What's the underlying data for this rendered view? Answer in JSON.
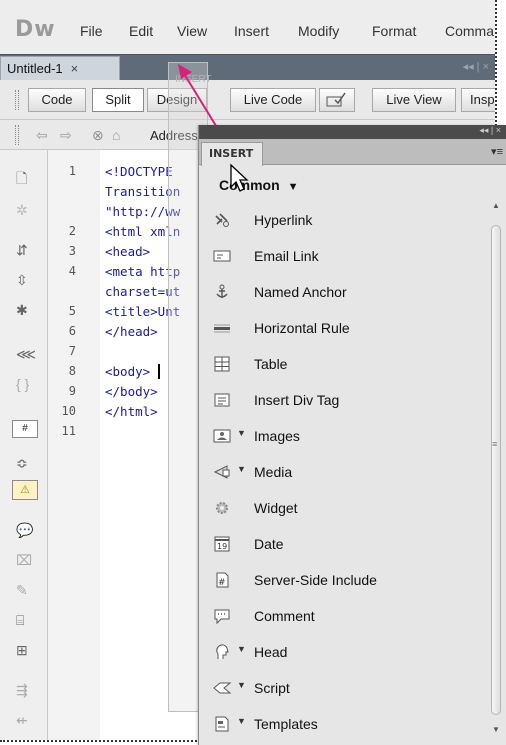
{
  "app": {
    "logo": "Dw"
  },
  "menu": [
    "File",
    "Edit",
    "View",
    "Insert",
    "Modify",
    "Format",
    "Comma"
  ],
  "document": {
    "tab_label": "Untitled-1",
    "tab_close": "×"
  },
  "window_controls": "◂◂ | ×",
  "toolbar": {
    "code": "Code",
    "split": "Split",
    "design": "Design",
    "live_code": "Live Code",
    "live_view": "Live View",
    "inspect": "Insp"
  },
  "address": {
    "label": "Address"
  },
  "code": {
    "line_numbers": [
      "1",
      "",
      "",
      "2",
      "3",
      "4",
      "",
      "5",
      "6",
      "7",
      "8",
      "9",
      "10",
      "11"
    ],
    "lines": [
      "<!DOCTYPE",
      "Transition",
      "\"http://ww",
      "<html xmln",
      "<head>",
      "<meta http",
      "charset=ut",
      "<title>Unt",
      "</head>",
      "",
      "<body>",
      "</body>",
      "</html>",
      ""
    ]
  },
  "ghost": {
    "title": "INSERT"
  },
  "panel": {
    "tab": "INSERT",
    "menu_icon": "▾≡",
    "collapse": "◂◂ | ×",
    "category": "Common",
    "category_arrow": "▼",
    "items": [
      {
        "label": "Hyperlink",
        "icon": "hyperlink-icon",
        "submenu": false
      },
      {
        "label": "Email Link",
        "icon": "email-link-icon",
        "submenu": false
      },
      {
        "label": "Named Anchor",
        "icon": "named-anchor-icon",
        "submenu": false
      },
      {
        "label": "Horizontal Rule",
        "icon": "horizontal-rule-icon",
        "submenu": false
      },
      {
        "label": "Table",
        "icon": "table-icon",
        "submenu": false
      },
      {
        "label": "Insert Div Tag",
        "icon": "div-tag-icon",
        "submenu": false
      },
      {
        "label": "Images",
        "icon": "images-icon",
        "submenu": true
      },
      {
        "label": "Media",
        "icon": "media-icon",
        "submenu": true
      },
      {
        "label": "Widget",
        "icon": "widget-icon",
        "submenu": false
      },
      {
        "label": "Date",
        "icon": "date-icon",
        "submenu": false
      },
      {
        "label": "Server-Side Include",
        "icon": "server-side-include-icon",
        "submenu": false
      },
      {
        "label": "Comment",
        "icon": "comment-icon",
        "submenu": false
      },
      {
        "label": "Head",
        "icon": "head-icon",
        "submenu": true
      },
      {
        "label": "Script",
        "icon": "script-icon",
        "submenu": true
      },
      {
        "label": "Templates",
        "icon": "templates-icon",
        "submenu": true
      }
    ]
  },
  "colors": {
    "arrow": "#d6217a",
    "tab_bar": "#5f6b78",
    "code_text": "#1a1aa0"
  }
}
